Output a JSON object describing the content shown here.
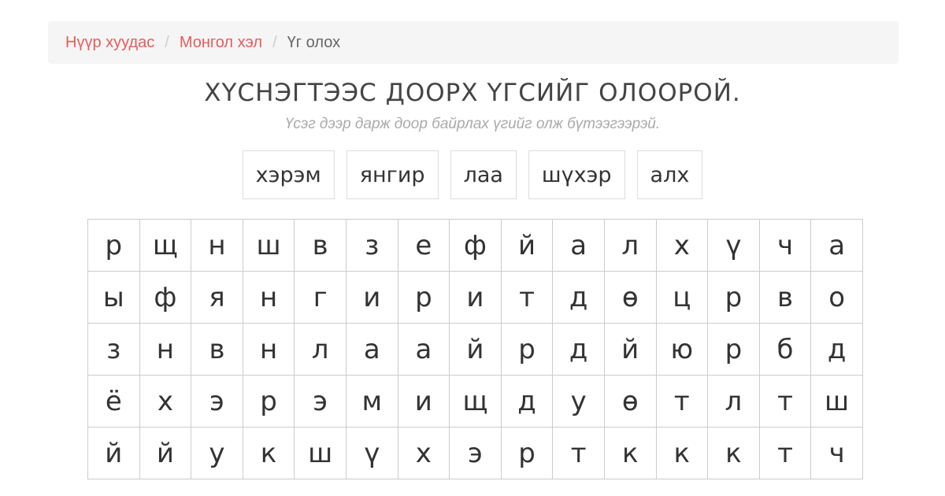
{
  "breadcrumb": {
    "home": "Нүүр хуудас",
    "section": "Монгол хэл",
    "current": "Үг олох",
    "separator": "/"
  },
  "title": "ХҮСНЭГТЭЭС ДООРХ ҮГСИЙГ ОЛООРОЙ.",
  "subtitle": "Үсэг дээр дарж доор байрлах үгийг олж бүтээгээрэй.",
  "words": [
    "хэрэм",
    "янгир",
    "лаа",
    "шүхэр",
    "алх"
  ],
  "grid": [
    [
      "р",
      "щ",
      "н",
      "ш",
      "в",
      "з",
      "е",
      "ф",
      "й",
      "а",
      "л",
      "х",
      "ү",
      "ч",
      "а"
    ],
    [
      "ы",
      "ф",
      "я",
      "н",
      "г",
      "и",
      "р",
      "и",
      "т",
      "д",
      "ө",
      "ц",
      "р",
      "в",
      "о"
    ],
    [
      "з",
      "н",
      "в",
      "н",
      "л",
      "а",
      "а",
      "й",
      "р",
      "д",
      "й",
      "ю",
      "р",
      "б",
      "д"
    ],
    [
      "ё",
      "х",
      "э",
      "р",
      "э",
      "м",
      "и",
      "щ",
      "д",
      "у",
      "ө",
      "т",
      "л",
      "т",
      "ш"
    ],
    [
      "й",
      "й",
      "у",
      "к",
      "ш",
      "ү",
      "х",
      "э",
      "р",
      "т",
      "к",
      "к",
      "к",
      "т",
      "ч"
    ]
  ],
  "colors": {
    "link": "#e65c5c",
    "breadcrumb_bg": "#f5f5f5",
    "subtitle": "#aaaaaa",
    "border": "#cccccc"
  }
}
